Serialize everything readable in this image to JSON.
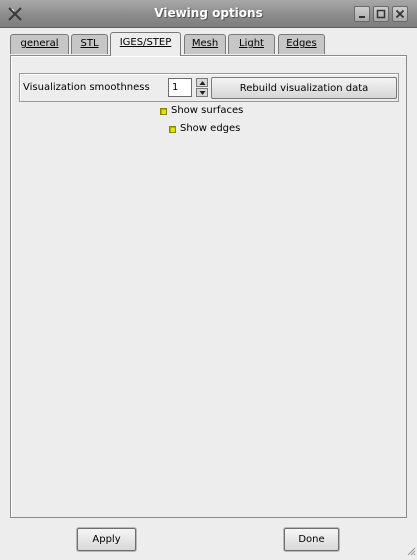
{
  "window": {
    "title": "Viewing options",
    "controls": [
      "minimize-icon",
      "maximize-icon",
      "close-icon"
    ]
  },
  "tabs": [
    {
      "label": "general"
    },
    {
      "label": "STL"
    },
    {
      "label": "IGES/STEP",
      "active": true
    },
    {
      "label": "Mesh"
    },
    {
      "label": "Light"
    },
    {
      "label": "Edges"
    }
  ],
  "iges": {
    "smoothness_label": "Visualization smoothness",
    "smoothness_value": "1",
    "rebuild_label": "Rebuild visualization data",
    "show_surfaces_label": "Show surfaces",
    "show_edges_label": "Show edges"
  },
  "footer": {
    "apply_label": "Apply",
    "done_label": "Done"
  },
  "colors": {
    "checkbox_fill": "#e7e300",
    "background": "#ededed",
    "titlebar": "#8c8c8c"
  }
}
